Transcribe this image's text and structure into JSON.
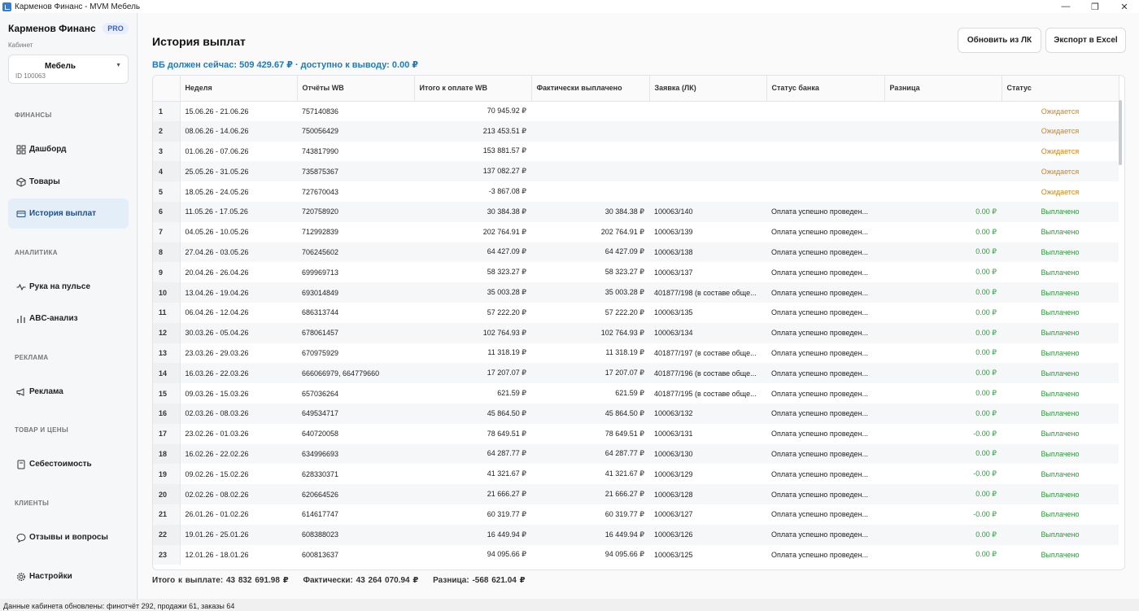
{
  "window": {
    "title": "Карменов Финанс - MVM Мебель",
    "controls": [
      "—",
      "❐",
      "✕"
    ]
  },
  "sidebar": {
    "brand": "Карменов Финанс",
    "badge": "PRO",
    "cabinet_label": "Кабинет",
    "cabinet_name": "Мебель",
    "cabinet_id": "ID 100063",
    "sections": {
      "finance": "ФИНАНСЫ",
      "analytics": "АНАЛИТИКА",
      "ads": "РЕКЛАМА",
      "goods": "ТОВАР И ЦЕНЫ",
      "clients": "КЛИЕНТЫ"
    },
    "items": {
      "dashboard": "Дашборд",
      "goods": "Товары",
      "payouts": "История выплат",
      "pulse": "Рука на пульсе",
      "abc": "ABC-анализ",
      "ads": "Реклама",
      "cost": "Себестоимость",
      "reviews": "Отзывы и вопросы",
      "settings": "Настройки"
    }
  },
  "main": {
    "title": "История выплат",
    "summary": "ВБ должен сейчас: 509 429.67 ₽ · доступно к выводу: 0.00 ₽",
    "refresh_button": "Обновить из ЛК",
    "export_button": "Экспорт в Excel",
    "columns": [
      "Неделя",
      "Отчёты WB",
      "Итого к оплате WB",
      "Фактически выплачено",
      "Заявка (ЛК)",
      "Статус банка",
      "Разница",
      "Статус"
    ],
    "rows": [
      [
        "1",
        "15.06.26 - 21.06.26",
        "757140836",
        "70 945.92 ₽",
        "",
        "",
        "",
        "",
        "Ожидается"
      ],
      [
        "2",
        "08.06.26 - 14.06.26",
        "750056429",
        "213 453.51 ₽",
        "",
        "",
        "",
        "",
        "Ожидается"
      ],
      [
        "3",
        "01.06.26 - 07.06.26",
        "743817990",
        "153 881.57 ₽",
        "",
        "",
        "",
        "",
        "Ожидается"
      ],
      [
        "4",
        "25.05.26 - 31.05.26",
        "735875367",
        "137 082.27 ₽",
        "",
        "",
        "",
        "",
        "Ожидается"
      ],
      [
        "5",
        "18.05.26 - 24.05.26",
        "727670043",
        "-3 867.08 ₽",
        "",
        "",
        "",
        "",
        "Ожидается"
      ],
      [
        "6",
        "11.05.26 - 17.05.26",
        "720758920",
        "30 384.38 ₽",
        "30 384.38 ₽",
        "100063/140",
        "Оплата успешно проведен...",
        "0.00 ₽",
        "Выплачено"
      ],
      [
        "7",
        "04.05.26 - 10.05.26",
        "712992839",
        "202 764.91 ₽",
        "202 764.91 ₽",
        "100063/139",
        "Оплата успешно проведен...",
        "0.00 ₽",
        "Выплачено"
      ],
      [
        "8",
        "27.04.26 - 03.05.26",
        "706245602",
        "64 427.09 ₽",
        "64 427.09 ₽",
        "100063/138",
        "Оплата успешно проведен...",
        "0.00 ₽",
        "Выплачено"
      ],
      [
        "9",
        "20.04.26 - 26.04.26",
        "699969713",
        "58 323.27 ₽",
        "58 323.27 ₽",
        "100063/137",
        "Оплата успешно проведен...",
        "0.00 ₽",
        "Выплачено"
      ],
      [
        "10",
        "13.04.26 - 19.04.26",
        "693014849",
        "35 003.28 ₽",
        "35 003.28 ₽",
        "401877/198 (в составе обще...",
        "Оплата успешно проведен...",
        "0.00 ₽",
        "Выплачено"
      ],
      [
        "11",
        "06.04.26 - 12.04.26",
        "686313744",
        "57 222.20 ₽",
        "57 222.20 ₽",
        "100063/135",
        "Оплата успешно проведен...",
        "0.00 ₽",
        "Выплачено"
      ],
      [
        "12",
        "30.03.26 - 05.04.26",
        "678061457",
        "102 764.93 ₽",
        "102 764.93 ₽",
        "100063/134",
        "Оплата успешно проведен...",
        "0.00 ₽",
        "Выплачено"
      ],
      [
        "13",
        "23.03.26 - 29.03.26",
        "670975929",
        "11 318.19 ₽",
        "11 318.19 ₽",
        "401877/197 (в составе обще...",
        "Оплата успешно проведен...",
        "0.00 ₽",
        "Выплачено"
      ],
      [
        "14",
        "16.03.26 - 22.03.26",
        "666066979, 664779660",
        "17 207.07 ₽",
        "17 207.07 ₽",
        "401877/196 (в составе обще...",
        "Оплата успешно проведен...",
        "0.00 ₽",
        "Выплачено"
      ],
      [
        "15",
        "09.03.26 - 15.03.26",
        "657036264",
        "621.59 ₽",
        "621.59 ₽",
        "401877/195 (в составе обще...",
        "Оплата успешно проведен...",
        "0.00 ₽",
        "Выплачено"
      ],
      [
        "16",
        "02.03.26 - 08.03.26",
        "649534717",
        "45 864.50 ₽",
        "45 864.50 ₽",
        "100063/132",
        "Оплата успешно проведен...",
        "0.00 ₽",
        "Выплачено"
      ],
      [
        "17",
        "23.02.26 - 01.03.26",
        "640720058",
        "78 649.51 ₽",
        "78 649.51 ₽",
        "100063/131",
        "Оплата успешно проведен...",
        "-0.00 ₽",
        "Выплачено"
      ],
      [
        "18",
        "16.02.26 - 22.02.26",
        "634996693",
        "64 287.77 ₽",
        "64 287.77 ₽",
        "100063/130",
        "Оплата успешно проведен...",
        "0.00 ₽",
        "Выплачено"
      ],
      [
        "19",
        "09.02.26 - 15.02.26",
        "628330371",
        "41 321.67 ₽",
        "41 321.67 ₽",
        "100063/129",
        "Оплата успешно проведен...",
        "-0.00 ₽",
        "Выплачено"
      ],
      [
        "20",
        "02.02.26 - 08.02.26",
        "620664526",
        "21 666.27 ₽",
        "21 666.27 ₽",
        "100063/128",
        "Оплата успешно проведен...",
        "0.00 ₽",
        "Выплачено"
      ],
      [
        "21",
        "26.01.26 - 01.02.26",
        "614617747",
        "60 319.77 ₽",
        "60 319.77 ₽",
        "100063/127",
        "Оплата успешно проведен...",
        "-0.00 ₽",
        "Выплачено"
      ],
      [
        "22",
        "19.01.26 - 25.01.26",
        "608388023",
        "16 449.94 ₽",
        "16 449.94 ₽",
        "100063/126",
        "Оплата успешно проведен...",
        "0.00 ₽",
        "Выплачено"
      ],
      [
        "23",
        "12.01.26 - 18.01.26",
        "600813637",
        "94 095.66 ₽",
        "94 095.66 ₽",
        "100063/125",
        "Оплата успешно проведен...",
        "0.00 ₽",
        "Выплачено"
      ]
    ],
    "totals": {
      "to_pay": "Итого к выплате: 43 832 691.98 ₽",
      "actual": "Фактически: 43 264 070.94 ₽",
      "diff": "Разница: -568 621.04 ₽"
    }
  },
  "status_bar": "Данные кабинета обновлены: финотчёт 292, продажи 61, заказы 64",
  "colors": {
    "accent": "#1f7ac0",
    "pending": "#d9820f",
    "paid": "#2e9a3c",
    "active_nav": "#e4eef9"
  }
}
